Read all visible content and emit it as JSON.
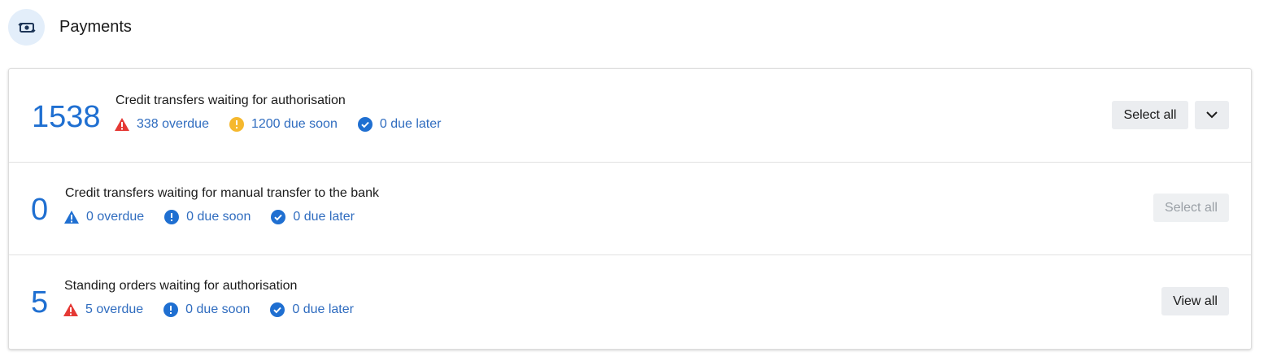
{
  "header": {
    "title": "Payments",
    "icon": "payments-exchange-icon"
  },
  "colors": {
    "accent": "#1f6fd1",
    "link": "#2f6cbf",
    "danger": "#e53935",
    "warning": "#f5b82e",
    "info": "#1f6fd1"
  },
  "rows": [
    {
      "count": "1538",
      "title": "Credit transfers waiting for authorisation",
      "overdue": "338 overdue",
      "overdue_icon": "warning-triangle-red-icon",
      "due_soon": "1200 due soon",
      "due_soon_icon": "exclamation-circle-yellow-icon",
      "due_later": "0 due later",
      "due_later_icon": "check-circle-icon",
      "button": "Select all",
      "has_dropdown": true
    },
    {
      "count": "0",
      "title": "Credit transfers waiting for manual transfer to the bank",
      "overdue": "0 overdue",
      "overdue_icon": "warning-triangle-blue-icon",
      "due_soon": "0 due soon",
      "due_soon_icon": "exclamation-circle-blue-icon",
      "due_later": "0 due later",
      "due_later_icon": "check-circle-icon",
      "button": "Select all",
      "button_disabled": true
    },
    {
      "count": "5",
      "title": "Standing orders waiting for authorisation",
      "overdue": "5 overdue",
      "overdue_icon": "warning-triangle-red-icon",
      "due_soon": "0 due soon",
      "due_soon_icon": "exclamation-circle-blue-icon",
      "due_later": "0 due later",
      "due_later_icon": "check-circle-icon",
      "button": "View all"
    }
  ]
}
